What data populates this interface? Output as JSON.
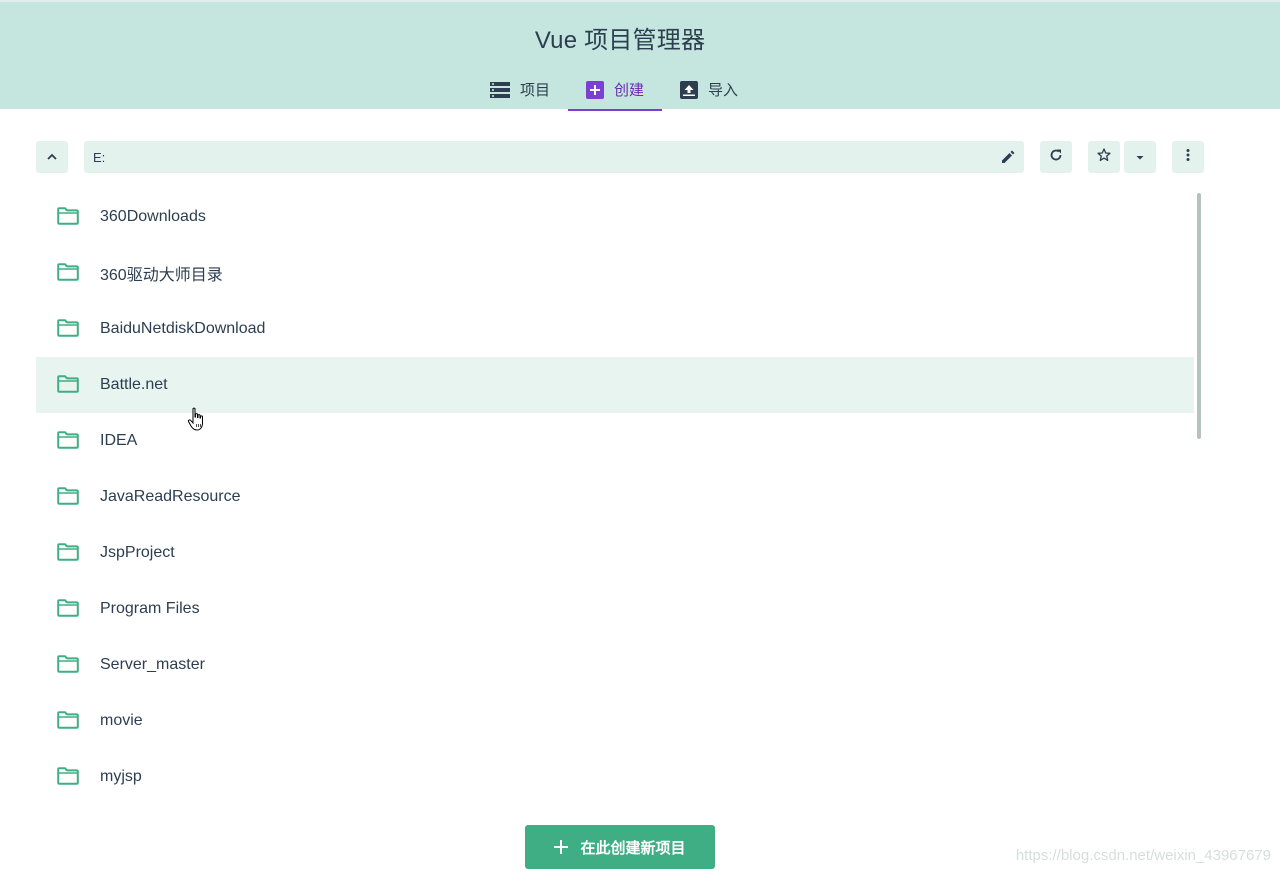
{
  "app": {
    "title": "Vue 项目管理器"
  },
  "tabs": [
    {
      "label": "项目",
      "icon": "list-icon",
      "active": false
    },
    {
      "label": "创建",
      "icon": "add-box-icon",
      "active": true
    },
    {
      "label": "导入",
      "icon": "import-icon",
      "active": false
    }
  ],
  "toolbar": {
    "path_value": "E:"
  },
  "folders": [
    {
      "name": "360Downloads"
    },
    {
      "name": "360驱动大师目录"
    },
    {
      "name": "BaiduNetdiskDownload"
    },
    {
      "name": "Battle.net",
      "hovered": true
    },
    {
      "name": "IDEA"
    },
    {
      "name": "JavaReadResource"
    },
    {
      "name": "JspProject"
    },
    {
      "name": "Program Files"
    },
    {
      "name": "Server_master"
    },
    {
      "name": "movie"
    },
    {
      "name": "myjsp"
    }
  ],
  "actions": {
    "create_label": "在此创建新项目"
  },
  "watermark": "https://blog.csdn.net/weixin_43967679",
  "colors": {
    "header_bg": "#c4e6de",
    "accent_purple": "#7b3fd1",
    "folder_green": "#3fae85",
    "button_green": "#3fae85"
  }
}
